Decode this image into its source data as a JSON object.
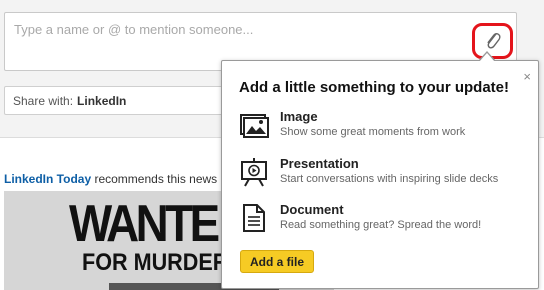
{
  "composer": {
    "placeholder": "Type a name or @ to mention someone...",
    "attach_icon": "paperclip-icon",
    "highlight_color": "#e4141b"
  },
  "share": {
    "prefix": "Share with:",
    "value": "LinkedIn"
  },
  "news": {
    "source_link": "LinkedIn Today",
    "text": " recommends this news",
    "image_headline": "WANTE",
    "image_subline": "FOR MURDER"
  },
  "popover": {
    "title": "Add a little something to your update!",
    "close_label": "×",
    "options": [
      {
        "label": "Image",
        "description": "Show some great moments from work",
        "icon": "image-icon"
      },
      {
        "label": "Presentation",
        "description": "Start conversations with inspiring slide decks",
        "icon": "presentation-icon"
      },
      {
        "label": "Document",
        "description": "Read something great? Spread the word!",
        "icon": "document-icon"
      }
    ],
    "add_file_label": "Add a file",
    "button_color": "#f6cb24"
  }
}
